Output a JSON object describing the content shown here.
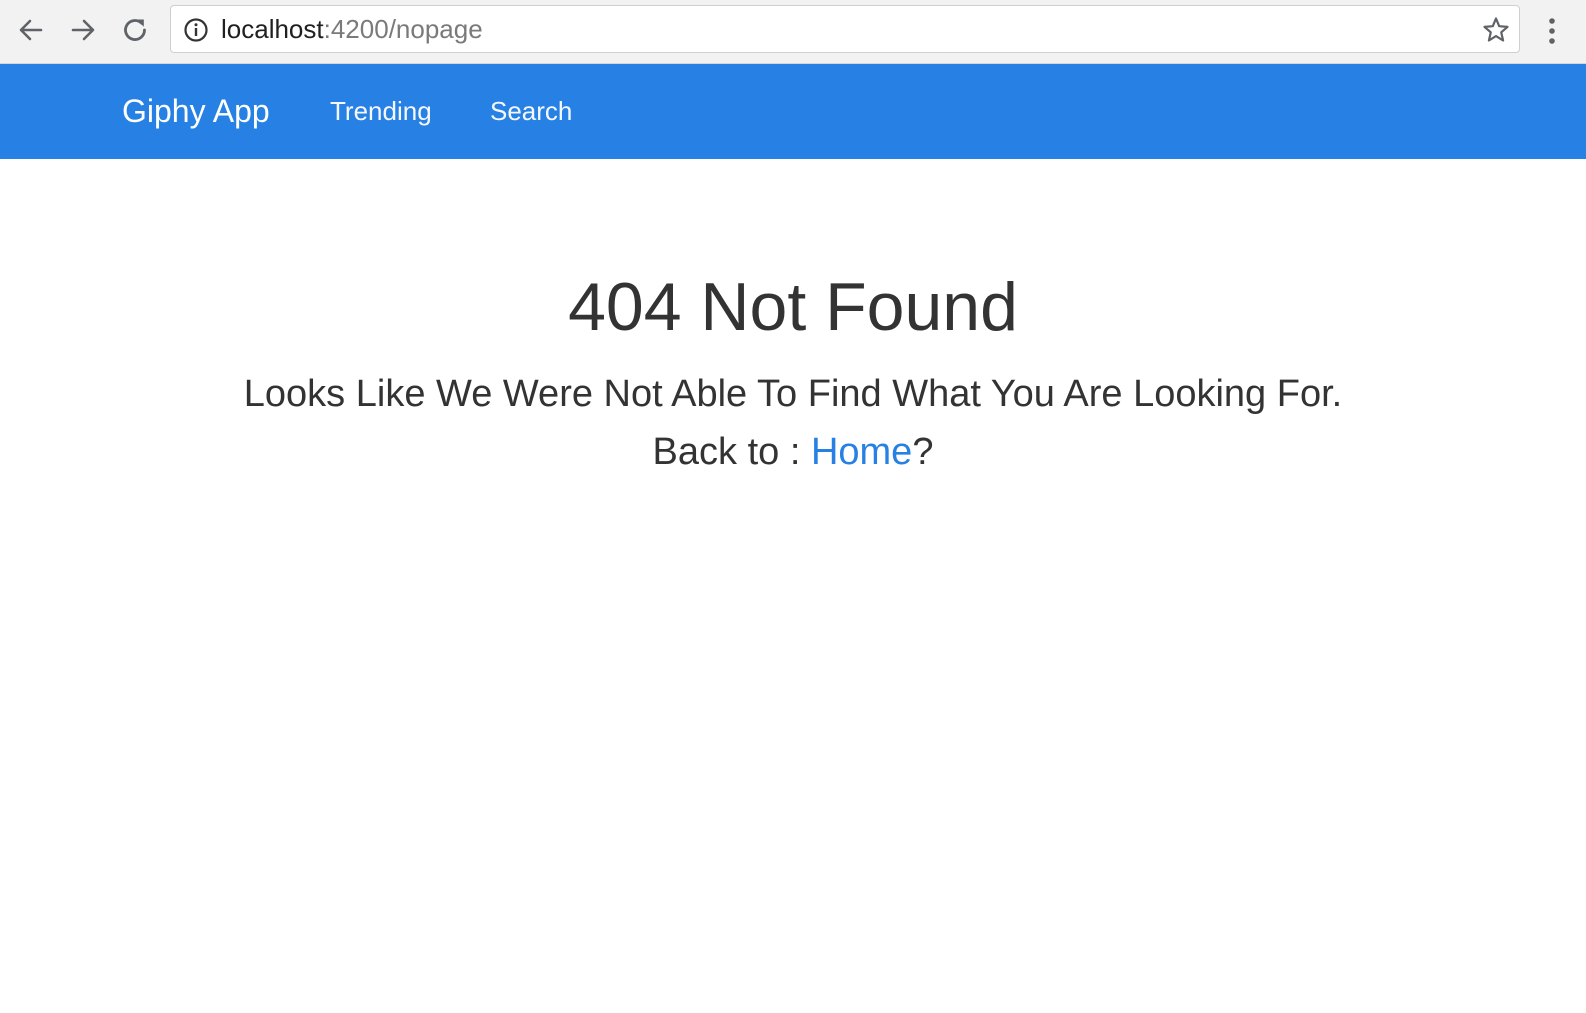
{
  "browser": {
    "url_host": "localhost",
    "url_path": ":4200/nopage"
  },
  "navbar": {
    "brand": "Giphy App",
    "links": [
      {
        "label": "Trending"
      },
      {
        "label": "Search"
      }
    ],
    "background_color": "#2780e3"
  },
  "main": {
    "title": "404 Not Found",
    "message": "Looks Like We Were Not Able To Find What You Are Looking For.",
    "back_prefix": "Back to : ",
    "home_link": "Home",
    "back_suffix": "?"
  },
  "icons": {
    "back": "arrow-left-icon",
    "forward": "arrow-right-icon",
    "reload": "reload-icon",
    "info": "info-icon",
    "bookmark": "star-icon",
    "menu": "kebab-menu-icon"
  }
}
